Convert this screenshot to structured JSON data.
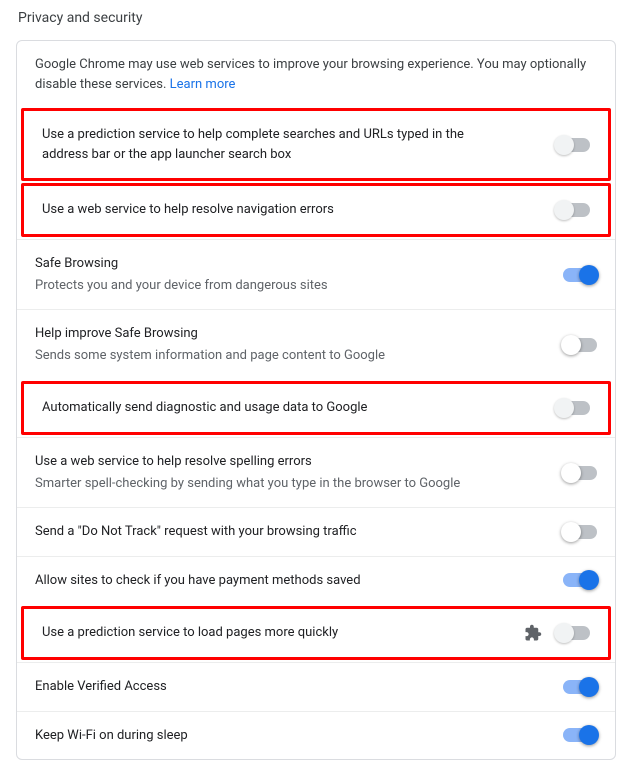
{
  "page": {
    "title": "Privacy and security"
  },
  "intro": {
    "text": "Google Chrome may use web services to improve your browsing experience. You may optionally disable these services. ",
    "link": "Learn more"
  },
  "rows": [
    {
      "title": "Use a prediction service to help complete searches and URLs typed in the address bar or the app launcher search box",
      "sub": "",
      "on": false,
      "highlight": true,
      "ext": false
    },
    {
      "title": "Use a web service to help resolve navigation errors",
      "sub": "",
      "on": false,
      "highlight": true,
      "ext": false
    },
    {
      "title": "Safe Browsing",
      "sub": "Protects you and your device from dangerous sites",
      "on": true,
      "highlight": false,
      "ext": false
    },
    {
      "title": "Help improve Safe Browsing",
      "sub": "Sends some system information and page content to Google",
      "on": false,
      "highlight": false,
      "ext": false
    },
    {
      "title": "Automatically send diagnostic and usage data to Google",
      "sub": "",
      "on": false,
      "highlight": true,
      "ext": false
    },
    {
      "title": "Use a web service to help resolve spelling errors",
      "sub": "Smarter spell-checking by sending what you type in the browser to Google",
      "on": false,
      "highlight": false,
      "ext": false
    },
    {
      "title": "Send a \"Do Not Track\" request with your browsing traffic",
      "sub": "",
      "on": false,
      "highlight": false,
      "ext": false
    },
    {
      "title": "Allow sites to check if you have payment methods saved",
      "sub": "",
      "on": true,
      "highlight": false,
      "ext": false
    },
    {
      "title": "Use a prediction service to load pages more quickly",
      "sub": "",
      "on": false,
      "highlight": true,
      "ext": true
    },
    {
      "title": "Enable Verified Access",
      "sub": "",
      "on": true,
      "highlight": false,
      "ext": false
    },
    {
      "title": "Keep Wi-Fi on during sleep",
      "sub": "",
      "on": true,
      "highlight": false,
      "ext": false
    }
  ]
}
